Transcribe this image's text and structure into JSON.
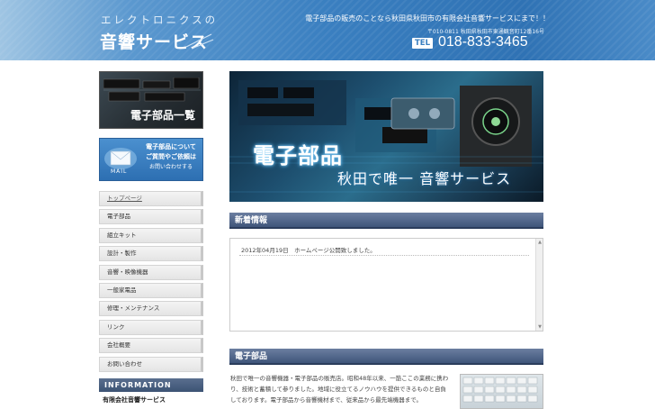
{
  "header": {
    "logo_sub": "エレクトロニクスの",
    "logo_main": "音響サービス",
    "tagline": "電子部品の販売のことなら秋田県秋田市の有限会社音響サービスにまで！！",
    "address": "〒010-0811 秋田県秋田市東通観音町12番16号",
    "tel_label": "TEL",
    "tel_number": "018-833-3465"
  },
  "sidebar": {
    "parts_banner_label": "電子部品一覧",
    "mail_banner": {
      "icon_label": "MAIL",
      "line1": "電子部品について",
      "line2": "ご質問やご依頼は",
      "line3": "お問い合わせする"
    },
    "nav": [
      {
        "label": "トップページ"
      },
      {
        "label": "電子部品"
      },
      {
        "label": "組立キット"
      },
      {
        "label": "設計・製作"
      },
      {
        "label": "音響・映像機器"
      },
      {
        "label": "一般家電品"
      },
      {
        "label": "修理・メンテナンス"
      },
      {
        "label": "リンク"
      },
      {
        "label": "会社概要"
      },
      {
        "label": "お問い合わせ"
      }
    ],
    "info_title": "INFORMATION",
    "company": "有限会社音響サービス"
  },
  "main": {
    "hero_title": "電子部品",
    "hero_sub": "秋田で唯一 音響サービス",
    "news_title": "新着情報",
    "news_entry": "2012年04月19日　ホームページ公開致しました。",
    "parts_title": "電子部品",
    "parts_text": "秋田で唯一の音響機器・電子部品の販売店。昭和48年以来、一筋ここの業務に携わり、技術と蓄積して参りました。地域に役立てるノウハウを提供できるものと自負しております。電子部品から音響機材まで、従来品から最先端機器まで。"
  },
  "colors": {
    "header_blue": "#3a7fc0",
    "section_head": "#3f557a",
    "nav_bg": "#e9e9e9"
  }
}
